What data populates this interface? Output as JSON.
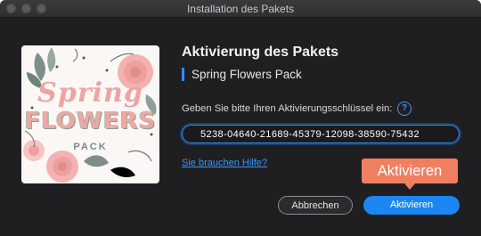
{
  "window": {
    "title": "Installation des Pakets",
    "traffic_lights": [
      "close-icon",
      "minimize-icon",
      "zoom-icon"
    ]
  },
  "thumbnail": {
    "line1": "Spring",
    "line2": "FLOWERS",
    "line3": "PACK"
  },
  "dialog": {
    "heading": "Aktivierung des Pakets",
    "pack_name": "Spring Flowers Pack",
    "prompt": "Geben Sie bitte Ihren Aktivierungsschlüssel ein:",
    "help_icon": "?",
    "key_value": "5238-04640-21689-45379-12098-38590-75432",
    "need_help_link": "Sie brauchen Hilfe?"
  },
  "buttons": {
    "cancel": "Abbrechen",
    "activate": "Aktivieren"
  },
  "callout": {
    "text": "Aktivieren"
  },
  "colors": {
    "accent": "#1c86f2",
    "callout": "#f07f5f",
    "background": "#1f1f22"
  }
}
